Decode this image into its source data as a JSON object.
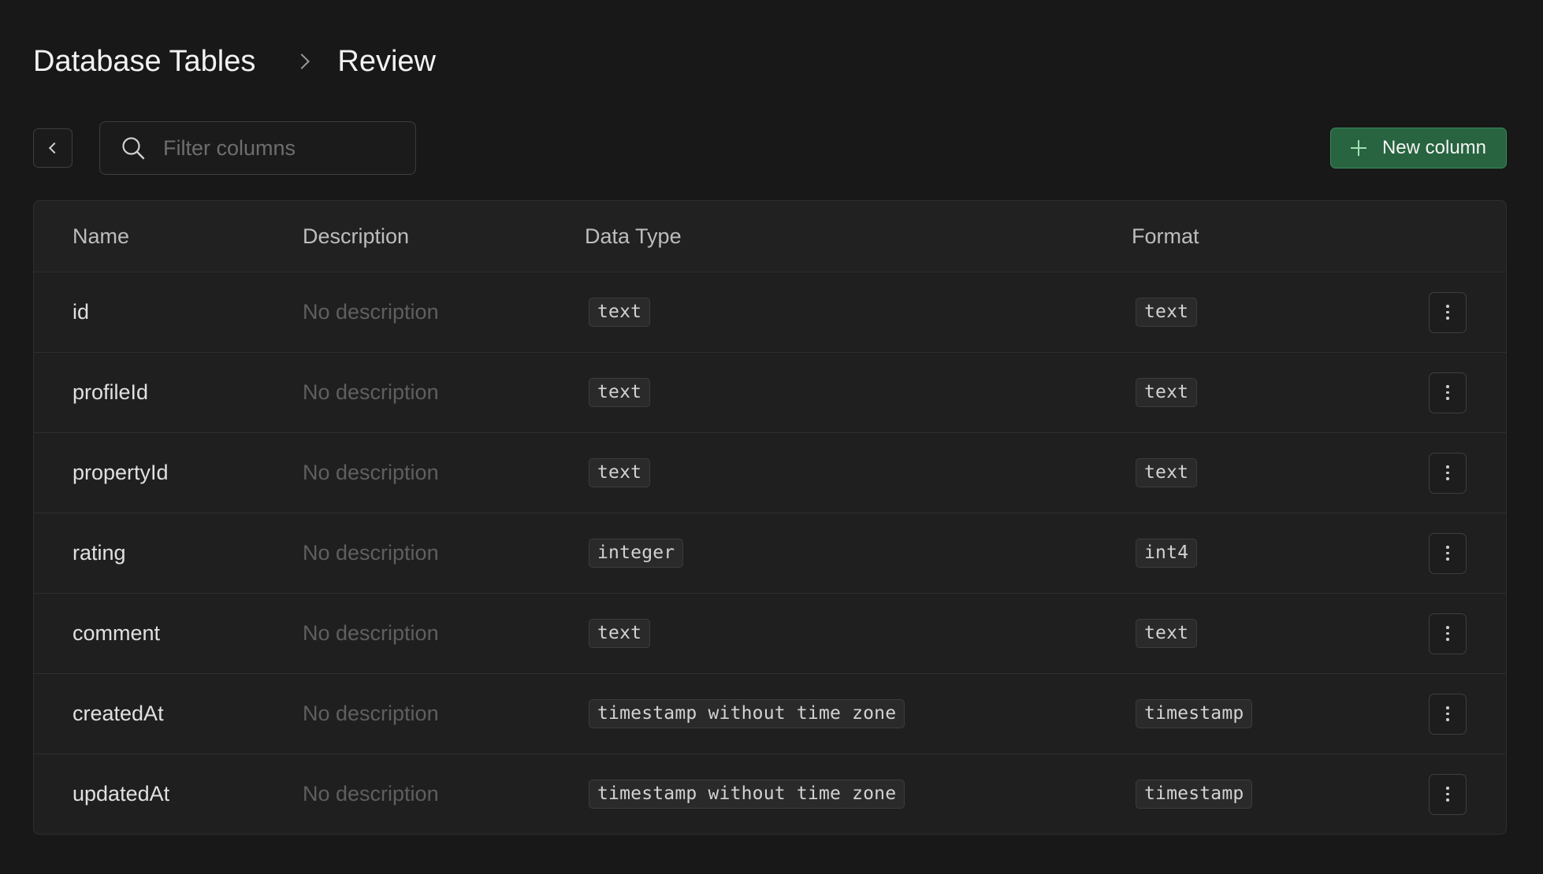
{
  "breadcrumb": {
    "root": "Database Tables",
    "current": "Review"
  },
  "toolbar": {
    "filter_placeholder": "Filter columns",
    "new_column_label": "New column"
  },
  "table": {
    "headers": {
      "name": "Name",
      "description": "Description",
      "data_type": "Data Type",
      "format": "Format"
    },
    "rows": [
      {
        "name": "id",
        "description": "No description",
        "data_type": "text",
        "format": "text"
      },
      {
        "name": "profileId",
        "description": "No description",
        "data_type": "text",
        "format": "text"
      },
      {
        "name": "propertyId",
        "description": "No description",
        "data_type": "text",
        "format": "text"
      },
      {
        "name": "rating",
        "description": "No description",
        "data_type": "integer",
        "format": "int4"
      },
      {
        "name": "comment",
        "description": "No description",
        "data_type": "text",
        "format": "text"
      },
      {
        "name": "createdAt",
        "description": "No description",
        "data_type": "timestamp without time zone",
        "format": "timestamp"
      },
      {
        "name": "updatedAt",
        "description": "No description",
        "data_type": "timestamp without time zone",
        "format": "timestamp"
      }
    ]
  },
  "icons": {
    "back": "chevron-left-icon",
    "search": "search-icon",
    "add": "plus-icon",
    "row_menu": "more-vertical-icon"
  },
  "colors": {
    "background": "#181818",
    "accent_button": "#27643f",
    "accent_border": "#3a8a5b"
  }
}
